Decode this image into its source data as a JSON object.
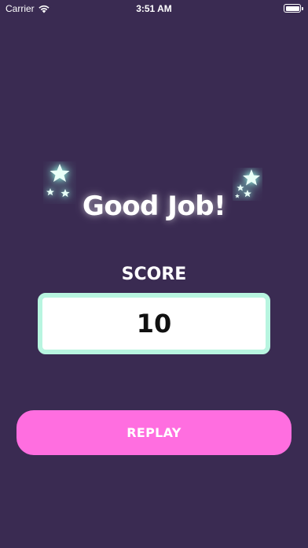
{
  "status_bar": {
    "carrier": "Carrier",
    "time": "3:51 AM"
  },
  "result": {
    "title": "Good Job!",
    "score_label": "SCORE",
    "score_value": "10"
  },
  "actions": {
    "replay_label": "REPLAY"
  },
  "icons": {
    "wifi": "wifi-icon",
    "battery": "battery-icon",
    "stars": "sparkle-stars-icon"
  },
  "colors": {
    "background": "#3a2b52",
    "score_border": "#b8f5e0",
    "replay_button": "#ff6ee0",
    "star_glow": "#8ff0dd"
  }
}
